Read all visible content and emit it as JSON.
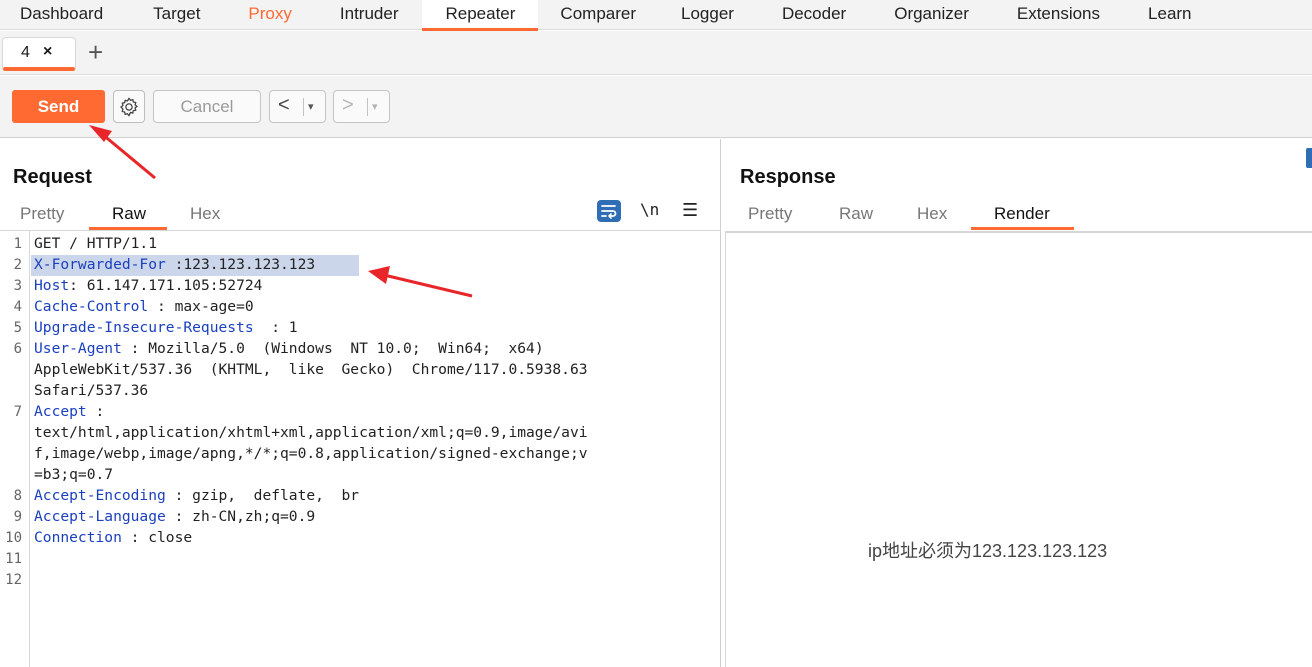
{
  "topnav": {
    "tabs": [
      {
        "label": "Dashboard"
      },
      {
        "label": "Target"
      },
      {
        "label": "Proxy"
      },
      {
        "label": "Intruder"
      },
      {
        "label": "Repeater"
      },
      {
        "label": "Comparer"
      },
      {
        "label": "Logger"
      },
      {
        "label": "Decoder"
      },
      {
        "label": "Organizer"
      },
      {
        "label": "Extensions"
      },
      {
        "label": "Learn"
      }
    ],
    "active": "Repeater",
    "accent_color": "#ff6a33"
  },
  "subtabs": {
    "items": [
      {
        "label": "4",
        "close": "×"
      }
    ],
    "add_label": "+"
  },
  "toolbar": {
    "send_label": "Send",
    "cancel_label": "Cancel",
    "back_label": "<",
    "forward_label": ">",
    "dropdown_glyph": "▾",
    "settings_icon": "gear-icon"
  },
  "request": {
    "title": "Request",
    "tabs": [
      "Pretty",
      "Raw",
      "Hex"
    ],
    "active_tab": "Raw",
    "icons": [
      "wrap-icon",
      "newline-icon",
      "menu-icon"
    ],
    "newline_label": "\\n",
    "menu_label": "☰",
    "line_numbers": [
      "1",
      "2",
      "3",
      "4",
      "5",
      "6",
      "7",
      "8",
      "9",
      "10",
      "11",
      "12"
    ],
    "lines": [
      {
        "key": "",
        "rest": "GET / HTTP/1.1"
      },
      {
        "key": "X-Forwarded-For",
        "rest": " :123.123.123.123"
      },
      {
        "key": "Host",
        "rest": ": 61.147.171.105:52724"
      },
      {
        "key": "Cache-Control",
        "rest": " : max-age=0"
      },
      {
        "key": "Upgrade-Insecure-Requests",
        "rest": "  : 1"
      },
      {
        "key": "User-Agent",
        "rest": " : Mozilla/5.0  (Windows  NT 10.0;  Win64;  x64)"
      },
      {
        "key": "",
        "rest": "AppleWebKit/537.36  (KHTML,  like  Gecko)  Chrome/117.0.5938.63"
      },
      {
        "key": "",
        "rest": "Safari/537.36"
      },
      {
        "key": "Accept",
        "rest": " :"
      },
      {
        "key": "",
        "rest": "text/html,application/xhtml+xml,application/xml;q=0.9,image/avi"
      },
      {
        "key": "",
        "rest": "f,image/webp,image/apng,*/*;q=0.8,application/signed-exchange;v"
      },
      {
        "key": "",
        "rest": "=b3;q=0.7"
      },
      {
        "key": "Accept-Encoding",
        "rest": " : gzip,  deflate,  br"
      },
      {
        "key": "Accept-Language",
        "rest": " : zh-CN,zh;q=0.9"
      },
      {
        "key": "Connection",
        "rest": " : close"
      }
    ]
  },
  "response": {
    "title": "Response",
    "tabs": [
      "Pretty",
      "Raw",
      "Hex",
      "Render"
    ],
    "active_tab": "Render",
    "render_text": "ip地址必须为123.123.123.123"
  }
}
